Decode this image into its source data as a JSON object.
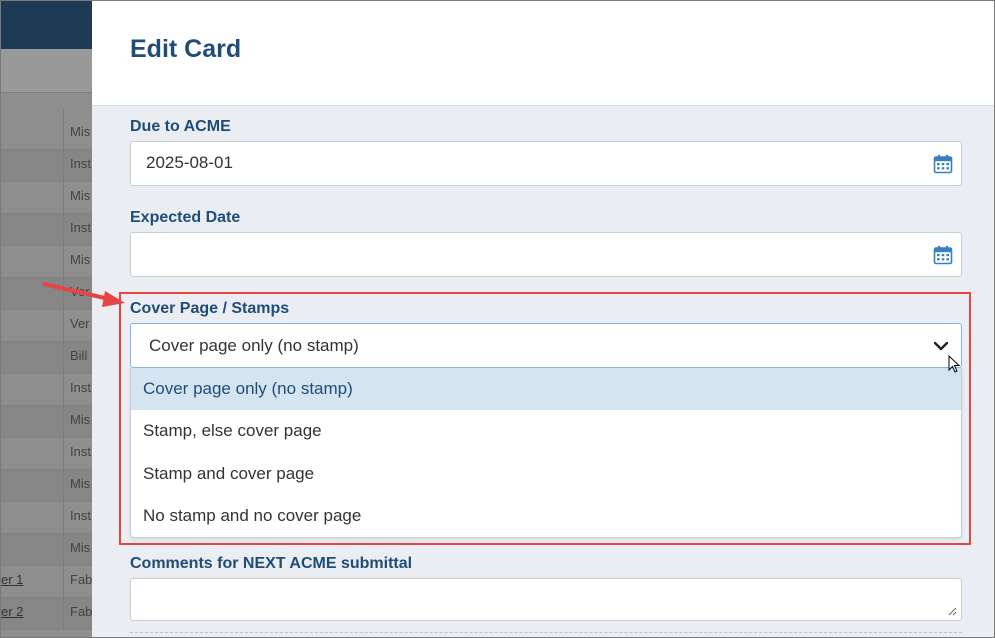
{
  "modal": {
    "title": "Edit Card"
  },
  "fields": {
    "due_to": {
      "label": "Due to ACME",
      "value": "2025-08-01"
    },
    "expected_date": {
      "label": "Expected Date",
      "value": ""
    },
    "cover_page": {
      "label": "Cover Page / Stamps",
      "selected": "Cover page only (no stamp)",
      "options": [
        "Cover page only (no stamp)",
        "Stamp, else cover page",
        "Stamp and cover page",
        "No stamp and no cover page"
      ]
    },
    "comments": {
      "label": "Comments for NEXT ACME submittal",
      "value": ""
    }
  },
  "background": {
    "rows": [
      {
        "link": "",
        "cell": "Mis"
      },
      {
        "link": "",
        "cell": "Inst"
      },
      {
        "link": "",
        "cell": "Mis"
      },
      {
        "link": "",
        "cell": "Inst"
      },
      {
        "link": "",
        "cell": "Mis"
      },
      {
        "link": "",
        "cell": "Ver"
      },
      {
        "link": "",
        "cell": "Ver"
      },
      {
        "link": "",
        "cell": "Bill"
      },
      {
        "link": "",
        "cell": "Inst"
      },
      {
        "link": "",
        "cell": "Mis"
      },
      {
        "link": "",
        "cell": "Inst"
      },
      {
        "link": "",
        "cell": "Mis"
      },
      {
        "link": "",
        "cell": "Inst"
      },
      {
        "link": "",
        "cell": "Mis"
      },
      {
        "link": "er 1",
        "cell": "Fab"
      },
      {
        "link": "er 2",
        "cell": "Fab"
      }
    ]
  },
  "colors": {
    "accent": "#1f4d78",
    "highlight": "#e54545",
    "selected_bg": "#d5e4f1"
  },
  "icons": {
    "calendar": "calendar-icon",
    "chevron": "chevron-down-icon",
    "resize": "resize-grip-icon",
    "annotation_arrow": "arrow-icon"
  }
}
